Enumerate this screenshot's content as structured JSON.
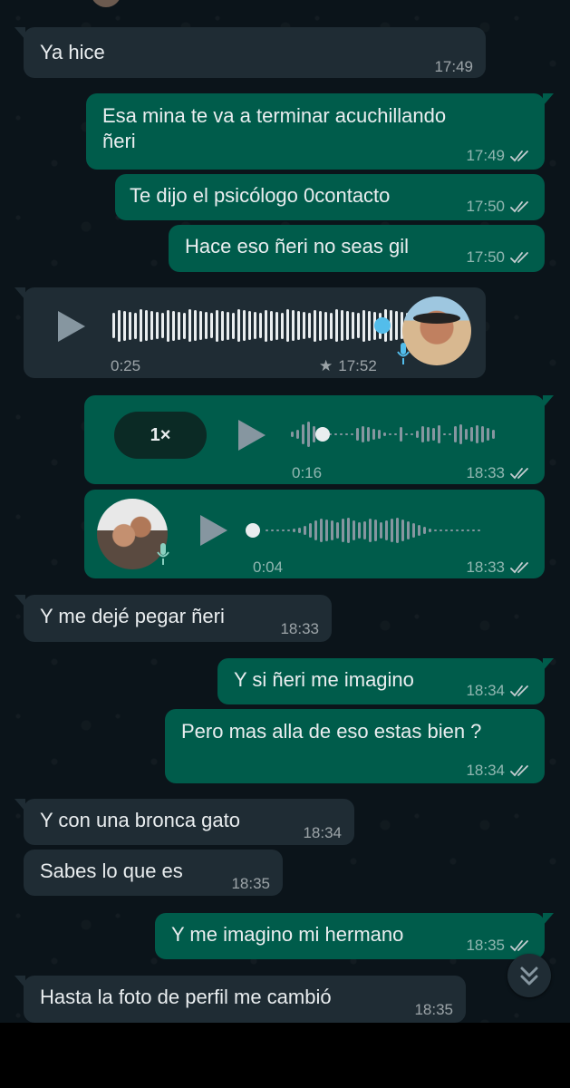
{
  "colors": {
    "background": "#0b141a",
    "incoming": "#1f2c34",
    "outgoing": "#005c4b",
    "read_ticks": "#8696a0",
    "mic_blue": "#53bdeb"
  },
  "messages": [
    {
      "dir": "in",
      "text": "Ya hice",
      "time": "17:49"
    },
    {
      "dir": "out",
      "text_lines": [
        "Esa mina te va a terminar acuchillando",
        "ñeri"
      ],
      "time": "17:49",
      "status": "read"
    },
    {
      "dir": "out",
      "text": "Te dijo el psicólogo 0contacto",
      "time": "17:50",
      "status": "read"
    },
    {
      "dir": "out",
      "text": "Hace eso ñeri no seas gil",
      "time": "17:50",
      "status": "read"
    },
    {
      "dir": "in",
      "type": "voice",
      "duration": "0:25",
      "time": "17:52",
      "starred": true,
      "icon": "star-icon"
    },
    {
      "dir": "out",
      "type": "voice",
      "speed": "1×",
      "duration": "0:16",
      "time": "18:33",
      "status": "read"
    },
    {
      "dir": "out",
      "type": "voice",
      "duration": "0:04",
      "time": "18:33",
      "status": "read"
    },
    {
      "dir": "in",
      "text": "Y me dejé pegar ñeri",
      "time": "18:33"
    },
    {
      "dir": "out",
      "text": "Y si ñeri me imagino",
      "time": "18:34",
      "status": "read"
    },
    {
      "dir": "out",
      "text": "Pero mas alla de eso estas bien ?",
      "time": "18:34",
      "status": "read"
    },
    {
      "dir": "in",
      "text": "Y con una bronca gato",
      "time": "18:34"
    },
    {
      "dir": "in",
      "text": "Sabes lo que es",
      "time": "18:35"
    },
    {
      "dir": "out",
      "text": "Y me imagino mi hermano",
      "time": "18:35",
      "status": "read"
    },
    {
      "dir": "in",
      "text": "Hasta la foto de perfil me cambió",
      "time": "18:35"
    }
  ],
  "scroll_button": {
    "icon": "double-chevron-down-icon"
  }
}
